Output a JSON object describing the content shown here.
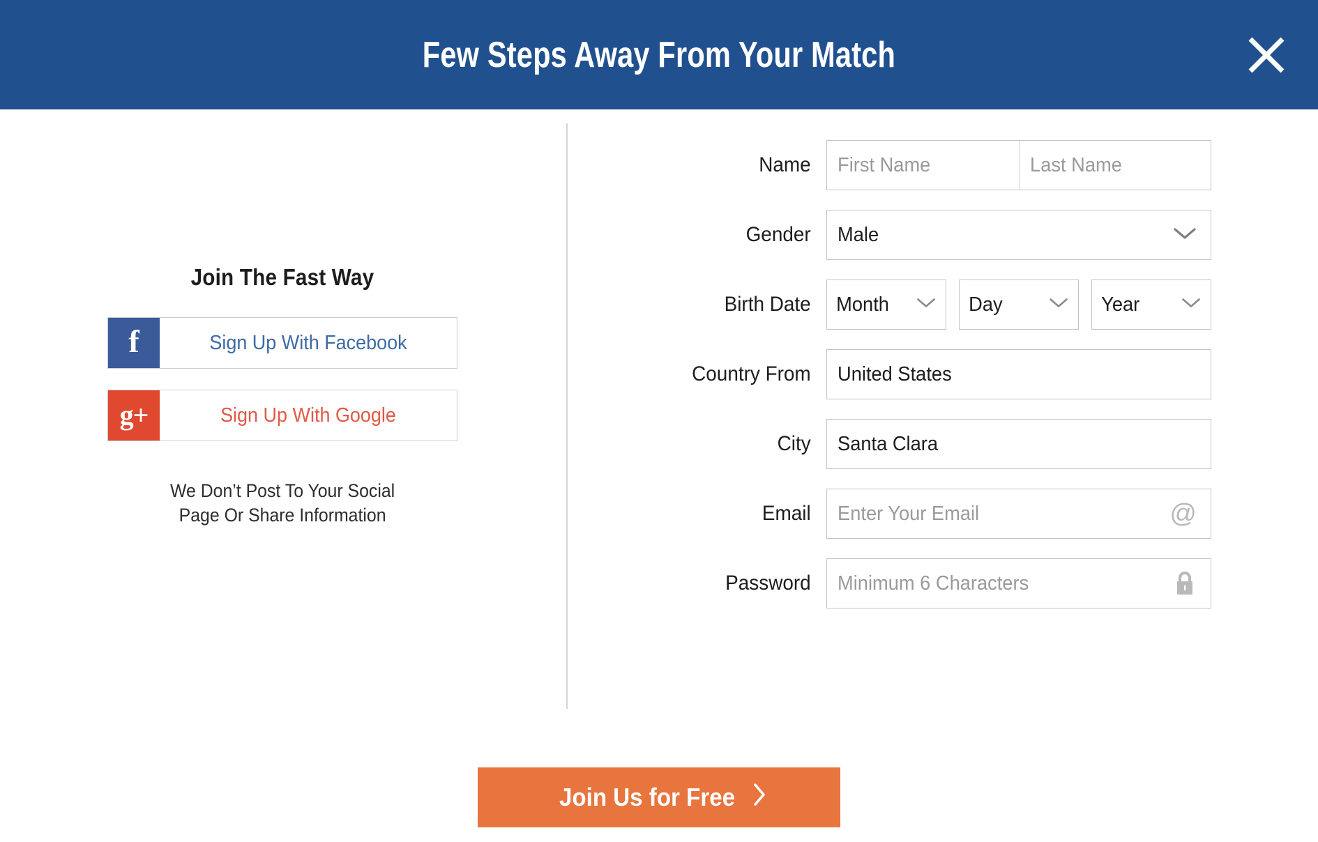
{
  "header": {
    "title": "Few Steps Away From Your Match",
    "close_icon": "close-x-icon",
    "background_color": "#21508f"
  },
  "social": {
    "heading": "Join The Fast Way",
    "buttons": [
      {
        "label": "Sign Up With Facebook",
        "icon": "facebook-f-icon",
        "glyph": "f",
        "icon_color": "#3a5a99",
        "text_color": "#3d6ba5"
      },
      {
        "label": "Sign Up With Google",
        "icon": "google-plus-icon",
        "glyph": "g+",
        "icon_color": "#e0492f",
        "text_color": "#e05a45"
      }
    ],
    "note_line1": "We Don’t Post To Your Social",
    "note_line2": "Page Or Share Information"
  },
  "form": {
    "name": {
      "label": "Name",
      "first_placeholder": "First Name",
      "first_value": "",
      "last_placeholder": "Last Name",
      "last_value": ""
    },
    "gender": {
      "label": "Gender",
      "value": "Male",
      "icon": "chevron-down-icon"
    },
    "birth_date": {
      "label": "Birth Date",
      "month": "Month",
      "day": "Day",
      "year": "Year",
      "icon": "chevron-down-icon"
    },
    "country": {
      "label": "Country From",
      "value": "United States"
    },
    "city": {
      "label": "City",
      "value": "Santa Clara"
    },
    "email": {
      "label": "Email",
      "placeholder": "Enter Your Email",
      "value": "",
      "icon": "at-sign-icon"
    },
    "password": {
      "label": "Password",
      "placeholder": "Minimum 6 Characters",
      "value": "",
      "icon": "lock-icon"
    }
  },
  "footer": {
    "submit_label": "Join Us for Free",
    "submit_icon": "chevron-right-icon",
    "submit_color": "#e8743e"
  }
}
